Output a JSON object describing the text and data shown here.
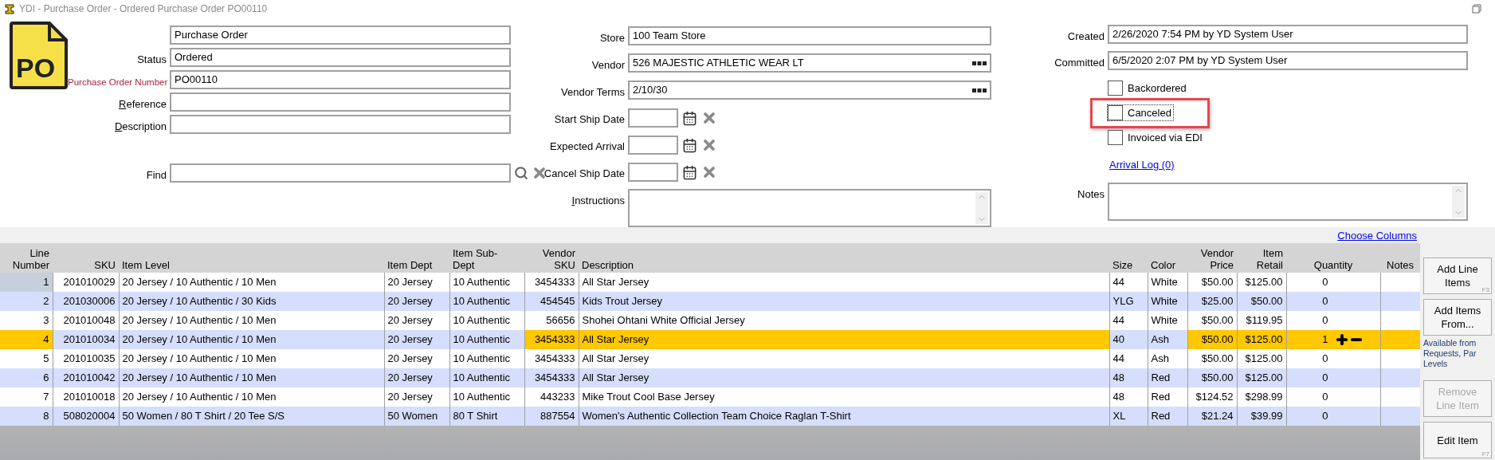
{
  "window": {
    "title": "YDI - Purchase Order - Ordered Purchase Order PO00110"
  },
  "logo": {
    "text": "PO"
  },
  "left_fields": [
    {
      "kind": "text",
      "value": "Purchase Order"
    },
    {
      "kind": "text",
      "label": "Status",
      "value": "Ordered",
      "required": false
    },
    {
      "kind": "text",
      "label": "Purchase Order Number",
      "value": "PO00110",
      "required": true
    },
    {
      "kind": "text",
      "label": "Reference",
      "required": false,
      "underline_first": true
    },
    {
      "kind": "text",
      "label": "Description",
      "required": false,
      "underline_first": true
    },
    {
      "kind": "search",
      "label": "Find",
      "required": false
    }
  ],
  "middle_fields": [
    {
      "kind": "text",
      "label": "Store",
      "value": "100 Team Store"
    },
    {
      "kind": "lookup",
      "label": "Vendor",
      "value": "526 MAJESTIC ATHLETIC WEAR LT"
    },
    {
      "kind": "lookup",
      "label": "Vendor Terms",
      "value": "2/10/30"
    },
    {
      "kind": "date",
      "label": "Start Ship Date"
    },
    {
      "kind": "date",
      "label": "Expected Arrival"
    },
    {
      "kind": "date",
      "label": "Cancel Ship Date"
    },
    {
      "kind": "memo",
      "label": "Instructions",
      "underline_first": true
    }
  ],
  "right_fields": [
    {
      "kind": "text",
      "label": "Created",
      "value": "2/26/2020 7:54 PM by YD System User"
    },
    {
      "kind": "text",
      "label": "Committed",
      "value": "6/5/2020 2:07 PM by YD System User"
    },
    {
      "kind": "checkbox",
      "text": "Backordered",
      "checked": false,
      "highlighted": false,
      "focused": false
    },
    {
      "kind": "checkbox",
      "text": "Canceled",
      "checked": false,
      "highlighted": true,
      "focused": true
    },
    {
      "kind": "checkbox",
      "text": "Invoiced via EDI",
      "checked": false,
      "highlighted": false,
      "focused": false
    },
    {
      "kind": "link",
      "text": "Arrival Log (0)"
    },
    {
      "kind": "memo",
      "label": "Notes"
    }
  ],
  "choose_columns": "Choose Columns",
  "table": {
    "columns": [
      {
        "label": [
          "Line",
          "Number"
        ],
        "editable": true
      },
      {
        "label": [
          "SKU"
        ],
        "editable": false
      },
      {
        "label": [
          "Item Level"
        ],
        "editable": false
      },
      {
        "label": [
          "Item Dept"
        ],
        "editable": false
      },
      {
        "label": [
          "Item Sub-",
          "Dept"
        ],
        "editable": false
      },
      {
        "label": [
          "Vendor",
          "SKU"
        ],
        "editable": true
      },
      {
        "label": [
          "Description"
        ],
        "editable": true
      },
      {
        "label": [
          "Size"
        ],
        "editable": false
      },
      {
        "label": [
          "Color"
        ],
        "editable": false
      },
      {
        "label": [
          "Vendor",
          "Price"
        ],
        "editable": true
      },
      {
        "label": [
          "Item",
          "Retail"
        ],
        "editable": true
      },
      {
        "label": [
          "Quantity"
        ],
        "editable": true
      },
      {
        "label": [
          "Notes"
        ],
        "editable": true
      }
    ],
    "rows": [
      {
        "selected": false,
        "current": true,
        "cells": [
          "1",
          "201010029",
          "20 Jersey / 10 Authentic / 10 Men",
          "20 Jersey",
          "10 Authentic",
          "3454333",
          "All Star Jersey",
          "44",
          "White",
          "$50.00",
          "$125.00",
          "0"
        ]
      },
      {
        "selected": false,
        "current": false,
        "cells": [
          "2",
          "201030006",
          "20 Jersey / 10 Authentic / 30 Kids",
          "20 Jersey",
          "10 Authentic",
          "454545",
          "Kids Trout Jersey",
          "YLG",
          "White",
          "$25.00",
          "$50.00",
          "0"
        ]
      },
      {
        "selected": false,
        "current": false,
        "cells": [
          "3",
          "201010048",
          "20 Jersey / 10 Authentic / 10 Men",
          "20 Jersey",
          "10 Authentic",
          "56656",
          "Shohei Ohtani White Official Jersey",
          "44",
          "White",
          "$50.00",
          "$119.95",
          "0"
        ]
      },
      {
        "selected": true,
        "current": false,
        "cells": [
          "4",
          "201010034",
          "20 Jersey / 10 Authentic / 10 Men",
          "20 Jersey",
          "10 Authentic",
          "3454333",
          "All Star Jersey",
          "40",
          "Ash",
          "$50.00",
          "$125.00",
          "1"
        ]
      },
      {
        "selected": false,
        "current": false,
        "cells": [
          "5",
          "201010035",
          "20 Jersey / 10 Authentic / 10 Men",
          "20 Jersey",
          "10 Authentic",
          "3454333",
          "All Star Jersey",
          "44",
          "Ash",
          "$50.00",
          "$125.00",
          "0"
        ]
      },
      {
        "selected": false,
        "current": false,
        "cells": [
          "6",
          "201010042",
          "20 Jersey / 10 Authentic / 10 Men",
          "20 Jersey",
          "10 Authentic",
          "3454333",
          "All Star Jersey",
          "48",
          "Red",
          "$50.00",
          "$125.00",
          "0"
        ]
      },
      {
        "selected": false,
        "current": false,
        "cells": [
          "7",
          "201010018",
          "20 Jersey / 10 Authentic / 10 Men",
          "20 Jersey",
          "10 Authentic",
          "443233",
          "Mike Trout Cool Base Jersey",
          "48",
          "Red",
          "$124.52",
          "$298.99",
          "0"
        ]
      },
      {
        "selected": false,
        "current": false,
        "cells": [
          "8",
          "508020004",
          "50 Women / 80 T Shirt / 20 Tee S/S",
          "50 Women",
          "80 T Shirt",
          "887554",
          "Women's Authentic Collection Team Choice Raglan T-Shirt",
          "XL",
          "Red",
          "$21.24",
          "$39.99",
          "0"
        ]
      }
    ]
  },
  "buttons": [
    {
      "label": "Add Line Items",
      "shortcut": "F3",
      "disabled": false
    },
    {
      "label": "Add Items From...",
      "note": "Available from Requests, Par Levels",
      "disabled": false
    },
    {
      "label": "Remove Line Item",
      "disabled": true
    },
    {
      "label": "Edit Item",
      "shortcut": "F7",
      "disabled": false
    }
  ]
}
